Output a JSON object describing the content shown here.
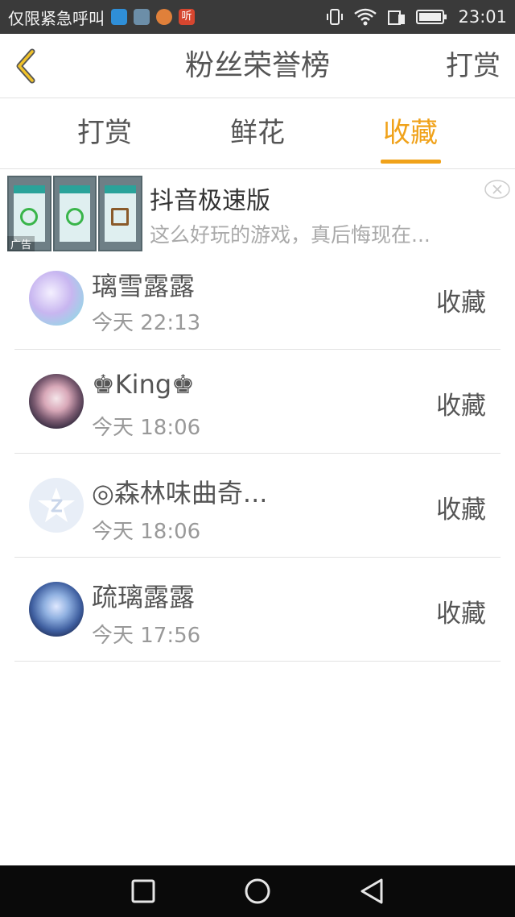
{
  "status_bar": {
    "carrier": "仅限紧急呼叫",
    "notif_badge": "听",
    "time": "23:01"
  },
  "header": {
    "title": "粉丝荣誉榜",
    "action_label": "打赏"
  },
  "tabs": [
    {
      "label": "打赏",
      "active": false
    },
    {
      "label": "鲜花",
      "active": false
    },
    {
      "label": "收藏",
      "active": true
    }
  ],
  "ad": {
    "title": "抖音极速版",
    "description": "这么好玩的游戏，真后悔现在...",
    "badge": "广告"
  },
  "fans": [
    {
      "name": "璃雪露露",
      "time": "今天 22:13",
      "action": "收藏"
    },
    {
      "name": "♚King♚",
      "time": "今天 18:06",
      "action": "收藏"
    },
    {
      "name": "◎森林味曲奇...",
      "time": "今天 18:06",
      "action": "收藏"
    },
    {
      "name": "疏璃露露",
      "time": "今天 17:56",
      "action": "收藏"
    }
  ],
  "colors": {
    "accent": "#f0a21a",
    "status_bar_bg": "#3a3a3a",
    "nav_bar_bg": "#0a0a0a"
  }
}
